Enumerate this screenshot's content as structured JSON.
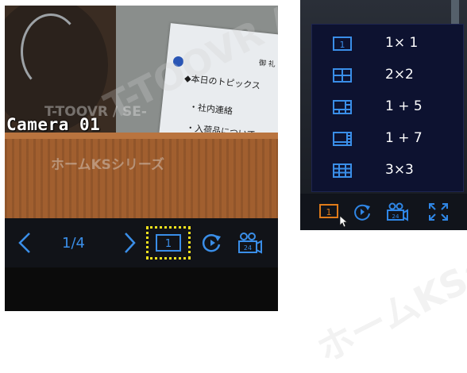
{
  "left_panel": {
    "camera_label": "Camera 01",
    "paper_lines": [
      "◆本日のトピックス",
      "・社内連絡",
      "・入荷品について",
      "御 礼"
    ],
    "toolbar": {
      "prev_icon": "chevron-left-icon",
      "page_indicator": "1/4",
      "next_icon": "chevron-right-icon",
      "layout_button_text": "1",
      "rotate_icon": "rotate-icon",
      "record_icon": "record-camera-icon",
      "highlight_color": "#f2e21e"
    }
  },
  "right_panel": {
    "layout_menu": [
      {
        "icon": "layout-1x1-icon",
        "icon_text": "1",
        "label": "1× 1"
      },
      {
        "icon": "layout-2x2-icon",
        "icon_text": "",
        "label": "2×2"
      },
      {
        "icon": "layout-1plus5-icon",
        "icon_text": "",
        "label": "1 + 5"
      },
      {
        "icon": "layout-1plus7-icon",
        "icon_text": "",
        "label": "1 + 7"
      },
      {
        "icon": "layout-3x3-icon",
        "icon_text": "",
        "label": "3×3"
      }
    ],
    "toolbar": {
      "layout_button_text": "1",
      "rotate_icon": "rotate-icon",
      "record_icon": "record-camera-icon",
      "fullscreen_icon": "fullscreen-icon"
    }
  },
  "colors": {
    "accent_blue": "#2f86e6",
    "menu_background": "#0d1230",
    "highlight_layout_button": "#e07b1a",
    "label_text": "#ffffff"
  },
  "watermark": {
    "text": "T-TOOVR / SE-",
    "text2": "ホームKSシリーズ",
    "overlay_small_1": "T-TOOVR / SE-",
    "overlay_small_2": "ホームKSシリーズ"
  }
}
